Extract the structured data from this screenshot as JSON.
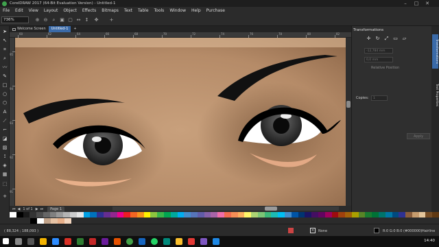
{
  "window": {
    "title": "CorelDRAW 2017 (64-Bit Evaluation Version) - Untitled-1",
    "controls": [
      "–",
      "□",
      "✕"
    ]
  },
  "menu": [
    "File",
    "Edit",
    "View",
    "Layout",
    "Object",
    "Effects",
    "Bitmaps",
    "Text",
    "Table",
    "Tools",
    "Window",
    "Help",
    "Purchase"
  ],
  "toolbar": {
    "zoom_value": "736%"
  },
  "tabs": [
    {
      "label": "Welcome Screen",
      "active": false
    },
    {
      "label": "Untitled-1",
      "active": true
    }
  ],
  "ruler": {
    "h_labels": [
      "60",
      "62",
      "64",
      "66",
      "68",
      "70",
      "72",
      "74",
      "76",
      "78",
      "80",
      "82"
    ],
    "v_labels": [
      "95",
      "94",
      "93",
      "92",
      "91"
    ],
    "unit": "millimeters"
  },
  "page_nav": {
    "page_info": "1  of  1",
    "page_tab": "Page 1"
  },
  "docker": {
    "title": "Transformations",
    "fields": {
      "x_value": "-12,784 mm",
      "y_value": "0,0 mm",
      "relative_position": "Relative Position",
      "copies_label": "Copies:",
      "copies_value": "1",
      "apply_label": "Apply"
    },
    "side_tabs": [
      "Transformations",
      "Text Properties"
    ]
  },
  "status": {
    "coords": "( 88,324 ; 188,093 )",
    "fill_label": "None",
    "outline_color": "R:0 G:0 B:0 (#000000)",
    "outline_width": "Hairline"
  },
  "taskbar": {
    "time": "14:40"
  },
  "colors": {
    "accent": "#3a6aa8",
    "skin": "#b58c6b",
    "lower_lid": "#e8b08a"
  },
  "palette": [
    "#ffffff",
    "#000000",
    "#1a1a1a",
    "#333333",
    "#4d4d4d",
    "#666666",
    "#808080",
    "#999999",
    "#b3b3b3",
    "#cccccc",
    "#e6e6e6",
    "#00a0e3",
    "#0072bc",
    "#2e3192",
    "#662d91",
    "#92278f",
    "#ec008c",
    "#ed1c24",
    "#f26522",
    "#f7941d",
    "#fff200",
    "#8dc63f",
    "#39b54a",
    "#00a651",
    "#00a99d",
    "#00aeef",
    "#448ccb",
    "#5674b9",
    "#605ca8",
    "#8560a8",
    "#a864a8",
    "#f06eaa",
    "#f26c4f",
    "#f68e56",
    "#fbaf5d",
    "#fff568",
    "#acd373",
    "#7cc576",
    "#3cb878",
    "#1cbbb4",
    "#00bff3",
    "#438ccb",
    "#0054a6",
    "#003471",
    "#1b1464",
    "#440e62",
    "#630460",
    "#9e005d",
    "#9e0b0f",
    "#a0410d",
    "#a36209",
    "#aba000",
    "#598527",
    "#197b30",
    "#007236",
    "#00746b",
    "#0076a3",
    "#004a80",
    "#2e3192",
    "#8a5d3b",
    "#c69c6d",
    "#e3c59b",
    "#754c24",
    "#603913"
  ],
  "palette2": [
    "#000000",
    "#ffffff",
    "#c1a38a",
    "#e6c2a4",
    "#e8b08a",
    "#f3d6bf"
  ]
}
